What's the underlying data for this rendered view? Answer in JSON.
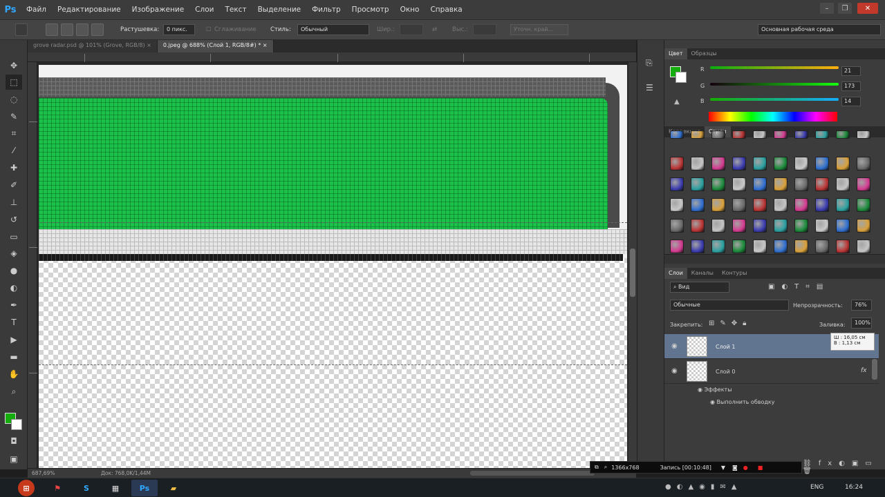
{
  "app": {
    "logo": "Ps"
  },
  "menu": [
    "Файл",
    "Редактирование",
    "Изображение",
    "Слои",
    "Текст",
    "Выделение",
    "Фильтр",
    "Просмотр",
    "Окно",
    "Справка"
  ],
  "options": {
    "feather_label": "Растушевка:",
    "feather_value": "0 пикс.",
    "antialias_label": "Сглаживание",
    "style_label": "Стиль:",
    "style_value": "Обычный",
    "width_label": "Шир.:",
    "height_label": "Выс.:",
    "refine_btn": "Уточн. край...",
    "workspace": "Основная рабочая среда"
  },
  "tabs": [
    {
      "label": "grove radar.psd @ 101% (Grove, RGB/8)",
      "active": false
    },
    {
      "label": "0.jpeg @ 688% (Слой 1, RGB/8#) *",
      "active": true
    }
  ],
  "status": {
    "zoom": "687,69%",
    "doc": "Док: 768,0K/1,44M"
  },
  "color_panel": {
    "tabs": [
      "Цвет",
      "Образцы"
    ],
    "r_label": "R",
    "g_label": "G",
    "b_label": "B",
    "r": "21",
    "g": "173",
    "b": "14",
    "fg_color": "#15ad0e"
  },
  "styles_panel": {
    "tabs": [
      "Коррекция",
      "Стили"
    ]
  },
  "layers_panel": {
    "tabs": [
      "Слои",
      "Каналы",
      "Контуры"
    ],
    "kind": "Вид",
    "blend": "Обычные",
    "opacity_label": "Непрозрачность:",
    "opacity": "76%",
    "lock_label": "Закрепить:",
    "fill_label": "Заливка:",
    "fill": "100%",
    "tooltip_w": "Ш : 16,05 см",
    "tooltip_h": "В : 1,13 см",
    "layers": [
      {
        "name": "Слой 1",
        "selected": true
      },
      {
        "name": "Слой 0",
        "selected": false,
        "fx": "fx"
      }
    ],
    "effects_label": "Эффекты",
    "stroke_label": "Выполнить обводку"
  },
  "recorder": {
    "size": "1366x768",
    "rec": "Запись [00:10:48]"
  },
  "taskbar": {
    "lang": "ENG",
    "time": "16:24"
  }
}
